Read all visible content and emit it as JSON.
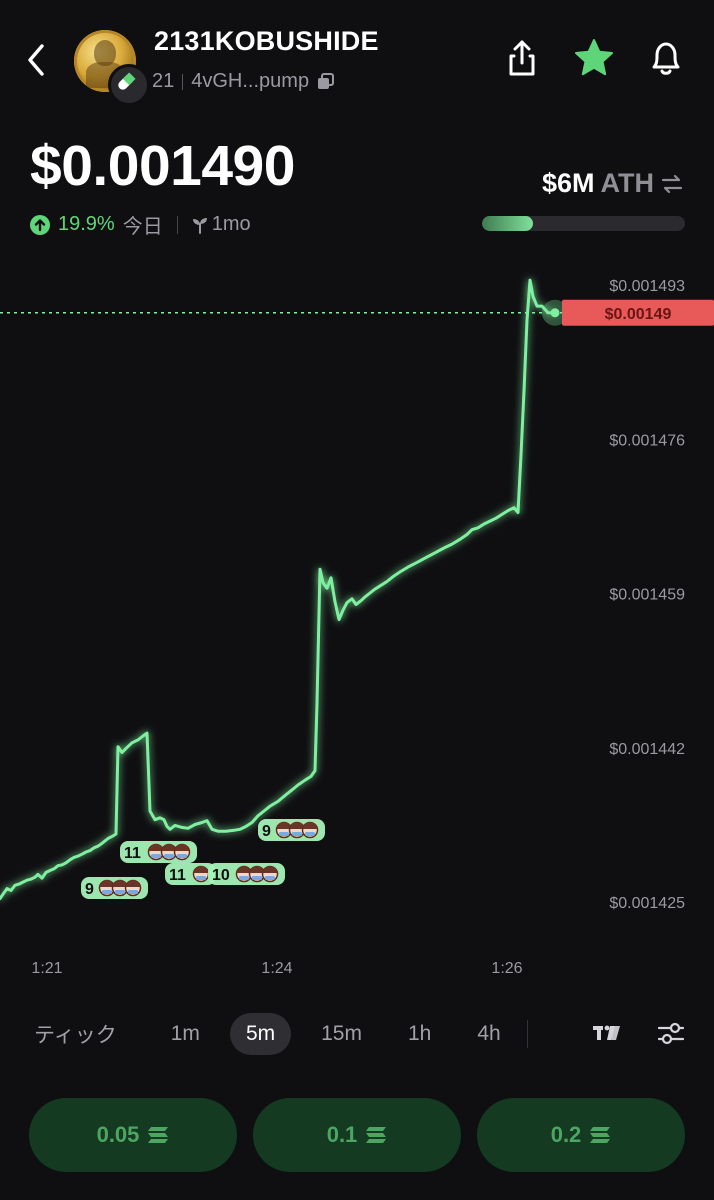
{
  "header": {
    "token_name": "2131KOBUSHIDE",
    "holders": "21",
    "contract": "4vGH...pump",
    "icons": {
      "back": "chevron-left-icon",
      "badge": "pill-icon",
      "copy": "copy-icon",
      "share": "share-icon",
      "favorite": "star-icon",
      "alert": "bell-icon"
    },
    "favorite_color": "#5fd57a"
  },
  "price": {
    "value": "$0.001490",
    "change_pct": "19.9%",
    "change_period": "今日",
    "age": "1mo",
    "change_color": "#5fd57a"
  },
  "market_cap": {
    "value": "$6M",
    "label": "ATH",
    "ath_progress": 0.25
  },
  "chart_data": {
    "type": "line",
    "y_ticks": [
      "$0.001493",
      "$0.001476",
      "$0.001459",
      "$0.001442",
      "$0.001425"
    ],
    "x_ticks": [
      "1:21",
      "1:24",
      "1:26"
    ],
    "current_price_label": "$0.00149",
    "line_color": "#7ff0a0",
    "price_line_color": "#e85a5a",
    "points": [
      [
        0,
        0.00142538
      ],
      [
        3,
        0.00142586
      ],
      [
        7,
        0.00142648
      ],
      [
        11,
        0.00142627
      ],
      [
        15,
        0.00142684
      ],
      [
        19,
        0.00142697
      ],
      [
        23,
        0.00142719
      ],
      [
        27,
        0.0014274
      ],
      [
        31,
        0.00142752
      ],
      [
        35,
        0.00142773
      ],
      [
        38,
        0.00142804
      ],
      [
        42,
        0.00142762
      ],
      [
        46,
        0.00142826
      ],
      [
        50,
        0.00142847
      ],
      [
        54,
        0.00142866
      ],
      [
        58,
        0.001429
      ],
      [
        62,
        0.00142909
      ],
      [
        66,
        0.00142932
      ],
      [
        70,
        0.00142965
      ],
      [
        74,
        0.00142992
      ],
      [
        78,
        0.00143006
      ],
      [
        82,
        0.00143027
      ],
      [
        86,
        0.00143051
      ],
      [
        90,
        0.00143067
      ],
      [
        94,
        0.00143097
      ],
      [
        98,
        0.00143115
      ],
      [
        102,
        0.00143147
      ],
      [
        108,
        0.001432
      ],
      [
        113,
        0.00143228
      ],
      [
        116,
        0.00143249
      ],
      [
        118,
        0.00144212
      ],
      [
        122,
        0.00144148
      ],
      [
        126,
        0.00144193
      ],
      [
        132,
        0.00144255
      ],
      [
        138,
        0.00144287
      ],
      [
        143,
        0.00144329
      ],
      [
        147,
        0.00144362
      ],
      [
        150,
        0.00143503
      ],
      [
        155,
        0.00143407
      ],
      [
        160,
        0.00143428
      ],
      [
        164,
        0.00143407
      ],
      [
        167,
        0.00143333
      ],
      [
        170,
        0.00143301
      ],
      [
        175,
        0.00143344
      ],
      [
        182,
        0.00143322
      ],
      [
        188,
        0.00143312
      ],
      [
        195,
        0.00143354
      ],
      [
        202,
        0.00143376
      ],
      [
        207,
        0.00143397
      ],
      [
        212,
        0.00143301
      ],
      [
        218,
        0.0014328
      ],
      [
        226,
        0.0014328
      ],
      [
        234,
        0.0014329
      ],
      [
        240,
        0.00143301
      ],
      [
        246,
        0.00143333
      ],
      [
        252,
        0.00143376
      ],
      [
        258,
        0.0014345
      ],
      [
        264,
        0.00143503
      ],
      [
        270,
        0.00143556
      ],
      [
        278,
        0.00143609
      ],
      [
        286,
        0.00143683
      ],
      [
        292,
        0.00143736
      ],
      [
        298,
        0.00143789
      ],
      [
        305,
        0.00143842
      ],
      [
        311,
        0.00143884
      ],
      [
        315,
        0.00143948
      ],
      [
        317,
        0.00144689
      ],
      [
        320,
        0.00146168
      ],
      [
        323,
        0.0014602
      ],
      [
        327,
        0.00145958
      ],
      [
        331,
        0.00146073
      ],
      [
        335,
        0.0014581
      ],
      [
        339,
        0.00145612
      ],
      [
        343,
        0.00145716
      ],
      [
        347,
        0.001458
      ],
      [
        352,
        0.00145842
      ],
      [
        356,
        0.00145779
      ],
      [
        361,
        0.00145821
      ],
      [
        365,
        0.00145863
      ],
      [
        370,
        0.00145906
      ],
      [
        375,
        0.00145948
      ],
      [
        381,
        0.0014599
      ],
      [
        387,
        0.00146032
      ],
      [
        393,
        0.00146085
      ],
      [
        400,
        0.00146138
      ],
      [
        408,
        0.00146191
      ],
      [
        417,
        0.00146243
      ],
      [
        426,
        0.00146296
      ],
      [
        435,
        0.00146349
      ],
      [
        444,
        0.00146402
      ],
      [
        452,
        0.00146444
      ],
      [
        460,
        0.00146497
      ],
      [
        467,
        0.0014655
      ],
      [
        472,
        0.00146603
      ],
      [
        478,
        0.00146624
      ],
      [
        484,
        0.00146666
      ],
      [
        490,
        0.00146698
      ],
      [
        496,
        0.0014673
      ],
      [
        502,
        0.00146772
      ],
      [
        508,
        0.00146814
      ],
      [
        514,
        0.00146846
      ],
      [
        518,
        0.00146793
      ],
      [
        521,
        0.00147427
      ],
      [
        524,
        0.00148131
      ],
      [
        527,
        0.00148912
      ],
      [
        530,
        0.00149354
      ],
      [
        533,
        0.00149174
      ],
      [
        537,
        0.00149068
      ],
      [
        542,
        0.00149068
      ],
      [
        548,
        0.00148994
      ],
      [
        555,
        0.00148994
      ]
    ],
    "trade_markers": [
      {
        "count": "9",
        "avatars": 3,
        "x": 0.001431
      },
      {
        "count": "11",
        "avatars": 3,
        "x": 0.001436
      },
      {
        "count": "11",
        "avatars": 1,
        "x": 0.001432
      },
      {
        "count": "10",
        "avatars": 3,
        "x": 0.001432
      },
      {
        "count": "9",
        "avatars": 3,
        "x": 0.00144
      }
    ]
  },
  "timeframes": [
    "ティック",
    "1m",
    "5m",
    "15m",
    "1h",
    "4h"
  ],
  "active_timeframe": "5m",
  "chart_tools": {
    "tradingview": "tradingview-icon",
    "settings": "sliders-icon"
  },
  "quick_buy": [
    {
      "amount": "0.05",
      "icon": "solana-icon"
    },
    {
      "amount": "0.1",
      "icon": "solana-icon"
    },
    {
      "amount": "0.2",
      "icon": "solana-icon"
    }
  ]
}
